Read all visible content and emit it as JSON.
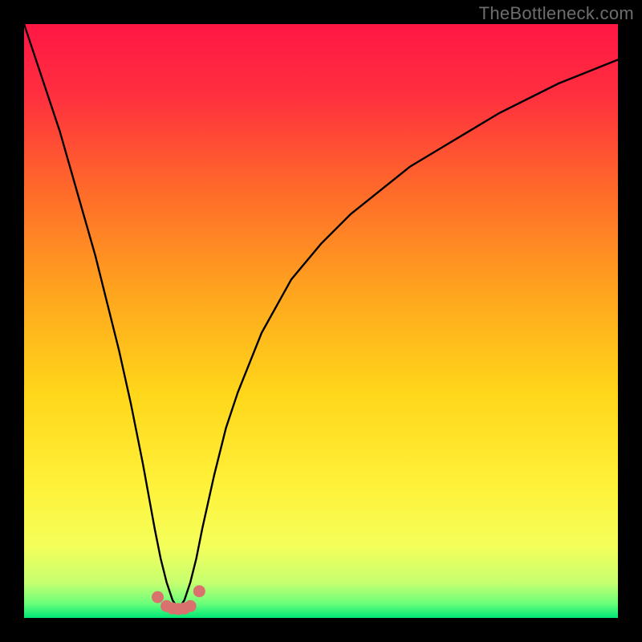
{
  "watermark": "TheBottleneck.com",
  "chart_data": {
    "type": "line",
    "title": "",
    "xlabel": "",
    "ylabel": "",
    "xlim": [
      0,
      100
    ],
    "ylim": [
      0,
      100
    ],
    "grid": false,
    "dip_x": 26,
    "series": [
      {
        "name": "curve",
        "stroke": "#000000",
        "x": [
          0,
          2,
          4,
          6,
          8,
          10,
          12,
          14,
          16,
          18,
          20,
          22,
          23,
          24,
          25,
          26,
          27,
          28,
          29,
          30,
          32,
          34,
          36,
          40,
          45,
          50,
          55,
          60,
          65,
          70,
          75,
          80,
          85,
          90,
          95,
          100
        ],
        "values": [
          100,
          94,
          88,
          82,
          75,
          68,
          61,
          53,
          45,
          36,
          26,
          15,
          10,
          6,
          3,
          1.5,
          3,
          6,
          10,
          15,
          24,
          32,
          38,
          48,
          57,
          63,
          68,
          72,
          76,
          79,
          82,
          85,
          87.5,
          90,
          92,
          94
        ]
      }
    ],
    "markers": {
      "name": "dip-dots",
      "color": "#d9716e",
      "x": [
        22.5,
        24,
        25,
        26,
        27,
        28,
        29.5
      ],
      "values": [
        3.5,
        2.0,
        1.6,
        1.5,
        1.6,
        2.0,
        4.5
      ]
    },
    "background_gradient": {
      "stops": [
        {
          "offset": 0.0,
          "color": "#ff1744"
        },
        {
          "offset": 0.12,
          "color": "#ff2f3f"
        },
        {
          "offset": 0.28,
          "color": "#ff6a2a"
        },
        {
          "offset": 0.45,
          "color": "#ffa41e"
        },
        {
          "offset": 0.62,
          "color": "#ffd61a"
        },
        {
          "offset": 0.78,
          "color": "#fff23a"
        },
        {
          "offset": 0.88,
          "color": "#f4ff5a"
        },
        {
          "offset": 0.94,
          "color": "#c7ff70"
        },
        {
          "offset": 0.975,
          "color": "#6eff7a"
        },
        {
          "offset": 1.0,
          "color": "#00e676"
        }
      ]
    }
  }
}
